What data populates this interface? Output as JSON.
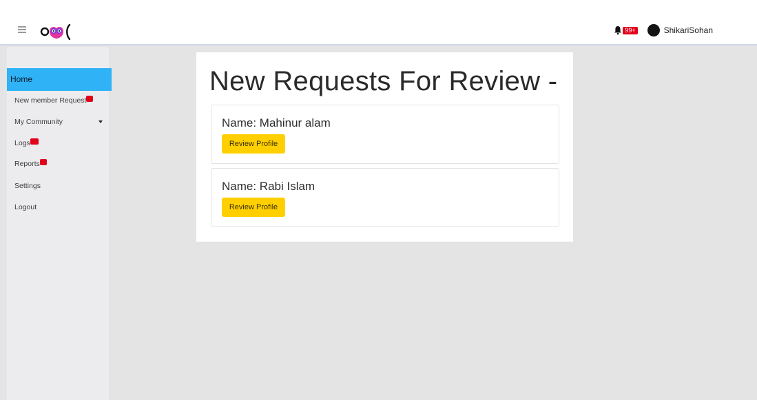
{
  "header": {
    "menu_icon": "hamburger-icon",
    "logo_icon": "owl-logo",
    "notification_icon": "bell-icon",
    "notification_count": "99+",
    "username": "ShikariSohan"
  },
  "sidebar": {
    "items": [
      {
        "label": "Home",
        "active": true
      },
      {
        "label": "New member Request",
        "badge": true
      },
      {
        "label": "My Community",
        "dropdown": true
      },
      {
        "label": "Logs",
        "badge": true
      },
      {
        "label": "Reports",
        "badge": true
      },
      {
        "label": "Settings"
      },
      {
        "label": "Logout"
      }
    ]
  },
  "main": {
    "title": "New Requests For Review -",
    "requests": [
      {
        "name": "Name: Mahinur alam",
        "button": "Review Profile"
      },
      {
        "name": "Name: Rabi Islam",
        "button": "Review Profile"
      }
    ]
  },
  "colors": {
    "active_nav": "#2fb2f6",
    "badge": "#e0001a",
    "button": "#ffcf00",
    "logo_pink": "#e6339a",
    "logo_purple": "#7d3ce0"
  }
}
